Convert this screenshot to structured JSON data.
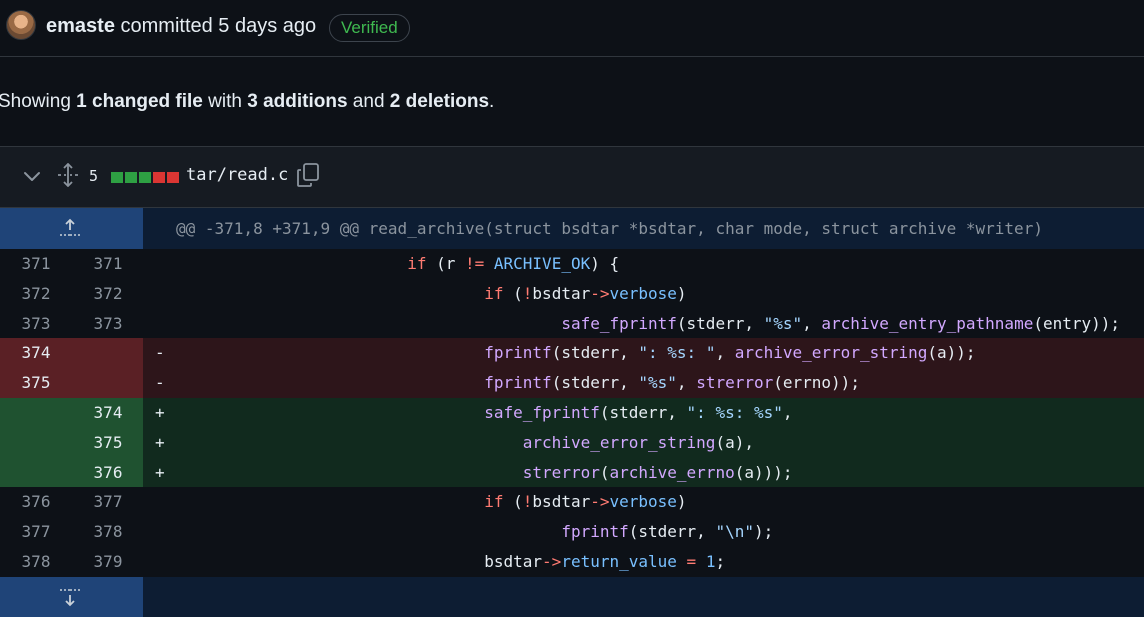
{
  "commit": {
    "author": "emaste",
    "action": "committed 5 days ago",
    "verified_label": "Verified"
  },
  "summary": {
    "prefix": "Showing ",
    "files": "1 changed file",
    "mid1": " with ",
    "additions": "3 additions",
    "mid2": " and ",
    "deletions": "2 deletions",
    "suffix": "."
  },
  "file": {
    "change_count": "5",
    "name": "tar/read.c",
    "diffstat": [
      "#2ea043",
      "#2ea043",
      "#2ea043",
      "#da3633",
      "#da3633"
    ],
    "icons": {
      "collapse": "chevron-down-icon",
      "expand": "unfold-icon",
      "copy": "copy-icon"
    }
  },
  "hunk_header": "@@ -371,8 +371,9 @@ read_archive(struct bsdtar *bsdtar, char mode, struct archive *writer)",
  "lines": [
    {
      "type": "ctx",
      "old": "371",
      "new": "371",
      "sign": "",
      "code": "                        if (r != ARCHIVE_OK) {"
    },
    {
      "type": "ctx",
      "old": "372",
      "new": "372",
      "sign": "",
      "code": "                                if (!bsdtar->verbose)"
    },
    {
      "type": "ctx",
      "old": "373",
      "new": "373",
      "sign": "",
      "code": "                                        safe_fprintf(stderr, \"%s\", archive_entry_pathname(entry));"
    },
    {
      "type": "del",
      "old": "374",
      "new": "",
      "sign": "-",
      "code": "                                fprintf(stderr, \": %s: \", archive_error_string(a));"
    },
    {
      "type": "del",
      "old": "375",
      "new": "",
      "sign": "-",
      "code": "                                fprintf(stderr, \"%s\", strerror(errno));"
    },
    {
      "type": "add",
      "old": "",
      "new": "374",
      "sign": "+",
      "code": "                                safe_fprintf(stderr, \": %s: %s\","
    },
    {
      "type": "add",
      "old": "",
      "new": "375",
      "sign": "+",
      "code": "                                    archive_error_string(a),"
    },
    {
      "type": "add",
      "old": "",
      "new": "376",
      "sign": "+",
      "code": "                                    strerror(archive_errno(a)));"
    },
    {
      "type": "ctx",
      "old": "376",
      "new": "377",
      "sign": "",
      "code": "                                if (!bsdtar->verbose)"
    },
    {
      "type": "ctx",
      "old": "377",
      "new": "378",
      "sign": "",
      "code": "                                        fprintf(stderr, \"\\n\");"
    },
    {
      "type": "ctx",
      "old": "378",
      "new": "379",
      "sign": "",
      "code": "                                bsdtar->return_value = 1;"
    }
  ],
  "colors": {
    "added": "#2ea043",
    "deleted": "#da3633",
    "verified": "#3fb950",
    "hunk_gutter": "#1f4478"
  }
}
